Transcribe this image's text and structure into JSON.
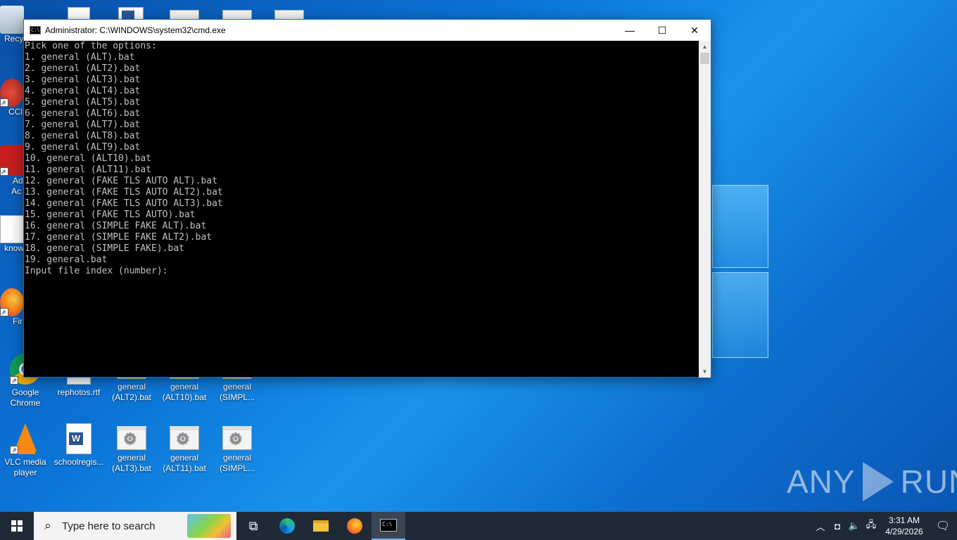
{
  "window": {
    "title": "Administrator: C:\\WINDOWS\\system32\\cmd.exe",
    "minimize": "—",
    "maximize": "☐",
    "close": "✕"
  },
  "console": {
    "lines": [
      "Pick one of the options:",
      "1. general (ALT).bat",
      "2. general (ALT2).bat",
      "3. general (ALT3).bat",
      "4. general (ALT4).bat",
      "5. general (ALT5).bat",
      "6. general (ALT6).bat",
      "7. general (ALT7).bat",
      "8. general (ALT8).bat",
      "9. general (ALT9).bat",
      "10. general (ALT10).bat",
      "11. general (ALT11).bat",
      "12. general (FAKE TLS AUTO ALT).bat",
      "13. general (FAKE TLS AUTO ALT2).bat",
      "14. general (FAKE TLS AUTO ALT3).bat",
      "15. general (FAKE TLS AUTO).bat",
      "16. general (SIMPLE FAKE ALT).bat",
      "17. general (SIMPLE FAKE ALT2).bat",
      "18. general (SIMPLE FAKE).bat",
      "19. general.bat",
      "Input file index (number):"
    ]
  },
  "desktop": {
    "left_partial": [
      "Recy",
      "CCl",
      "Ad",
      "Ac",
      "know",
      "Fir"
    ],
    "chrome": "Google Chrome",
    "vlc": "VLC media player",
    "rephotos": "rephotos.rtf",
    "schoolregis": "schoolregis...",
    "row1": [
      "general (ALT2).bat",
      "general (ALT10).bat",
      "general (SIMPL..."
    ],
    "row2": [
      "general (ALT3).bat",
      "general (ALT11).bat",
      "general (SIMPL..."
    ]
  },
  "taskbar": {
    "search_placeholder": "Type here to search",
    "time": "3:31 AM",
    "date": "4/29/2026"
  },
  "watermark": {
    "left": "ANY",
    "right": "RUN"
  }
}
